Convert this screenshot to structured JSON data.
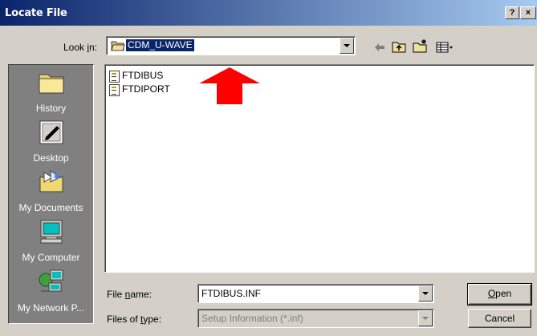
{
  "window": {
    "title": "Locate File",
    "help_label": "?",
    "close_label": "×"
  },
  "lookin": {
    "label_pre": "Look ",
    "label_accel": "i",
    "label_post": "n:",
    "value": "CDM_U-WAVE"
  },
  "sidebar": {
    "items": [
      {
        "label": "History",
        "icon": "history-folder-icon"
      },
      {
        "label": "Desktop",
        "icon": "desktop-icon"
      },
      {
        "label": "My Documents",
        "icon": "my-documents-icon"
      },
      {
        "label": "My Computer",
        "icon": "my-computer-icon"
      },
      {
        "label": "My Network P...",
        "icon": "network-places-icon"
      }
    ]
  },
  "files": [
    {
      "name": "FTDIBUS",
      "icon": "setup-info-file-icon"
    },
    {
      "name": "FTDIPORT",
      "icon": "setup-info-file-icon"
    }
  ],
  "filename": {
    "label_pre": "File ",
    "label_accel": "n",
    "label_post": "ame:",
    "value": "FTDIBUS.INF"
  },
  "filetype": {
    "label_pre": "Files of ",
    "label_accel": "t",
    "label_post": "ype:",
    "value": "Setup Information (*.inf)"
  },
  "buttons": {
    "open_accel": "O",
    "open_rest": "pen",
    "cancel": "Cancel"
  },
  "colors": {
    "title_gradient_start": "#0a246a",
    "title_gradient_end": "#a6caf0",
    "selection": "#0a246a",
    "annotation_arrow": "#ff0000",
    "dialog_face": "#d4d0c8"
  }
}
